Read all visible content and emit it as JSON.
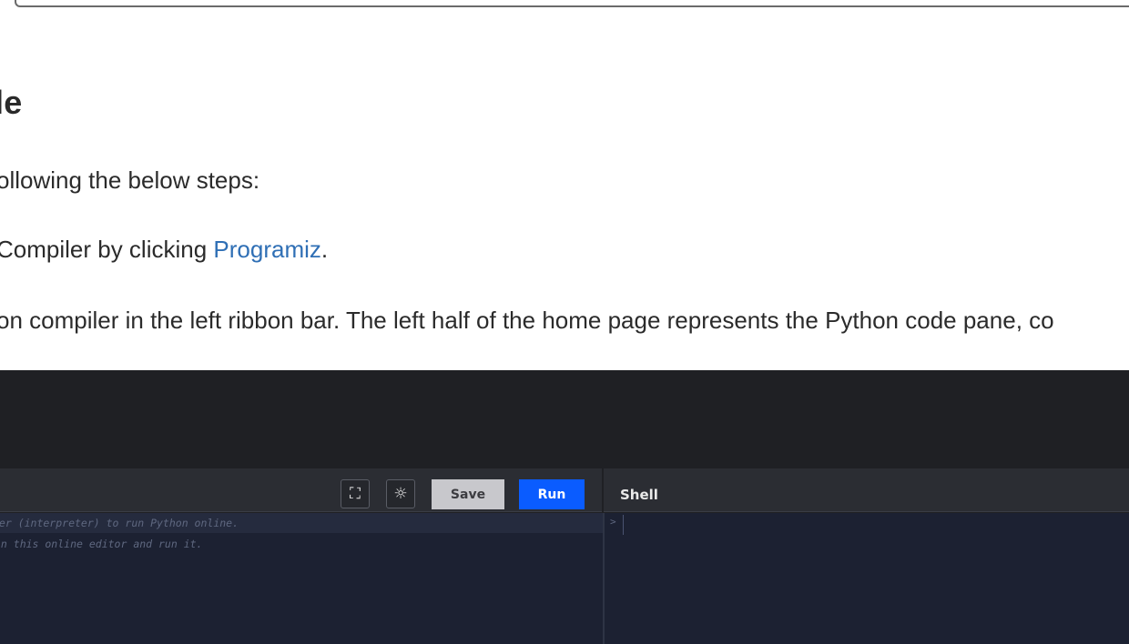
{
  "article": {
    "heading": "le",
    "para1": "ollowing the below steps:",
    "para2_before": "Compiler by clicking ",
    "para2_link": "Programiz",
    "para2_after": ".",
    "para3": "on compiler in the left ribbon bar. The left half of the home page represents the Python code pane, co"
  },
  "compiler": {
    "toolbar": {
      "fullscreen_icon": "fullscreen-icon",
      "theme_icon": "sun-icon",
      "save_label": "Save",
      "run_label": "Run"
    },
    "shell_label": "Shell",
    "code_lines": [
      "ler (interpreter) to run Python online.",
      " in this online editor and run it."
    ],
    "shell_prompt": ">"
  },
  "colors": {
    "link": "#2f6fb5",
    "run_button": "#0a5cff",
    "save_button": "#c8c8cc",
    "editor_bg": "#1c2132",
    "toolbar_bg": "#2b2d33"
  }
}
